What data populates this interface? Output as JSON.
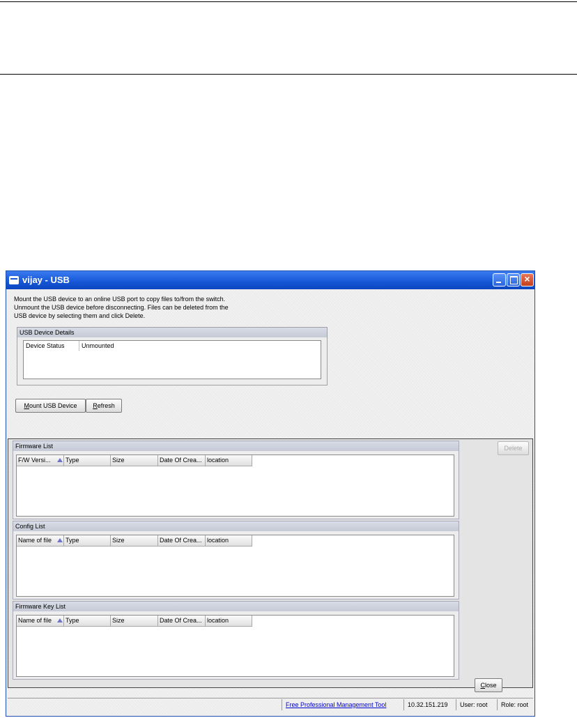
{
  "window": {
    "title": "vijay - USB",
    "close_glyph": "×"
  },
  "description": [
    "Mount the USB device to an online USB port to copy files to/from the switch.",
    "Unmount the USB device before disconnecting. Files can be deleted from the",
    "USB device by selecting them and click Delete."
  ],
  "usb_details": {
    "header": "USB Device Details",
    "rows": [
      {
        "label": "Device Status",
        "value": "Unmounted"
      }
    ]
  },
  "buttons": {
    "mount_mnemonic": "M",
    "mount_rest": "ount USB Device",
    "refresh_mnemonic": "R",
    "refresh_rest": "efresh",
    "delete": "Delete",
    "close_mnemonic": "C",
    "close_rest": "lose"
  },
  "firmware_list": {
    "header": "Firmware List",
    "columns": [
      "F/W Versi...",
      "Type",
      "Size",
      "Date Of Crea...",
      "location"
    ]
  },
  "config_list": {
    "header": "Config List",
    "columns": [
      "Name of file",
      "Type",
      "Size",
      "Date Of Crea...",
      "location"
    ]
  },
  "firmware_key_list": {
    "header": "Firmware Key List",
    "columns": [
      "Name of file",
      "Type",
      "Size",
      "Date Of Crea...",
      "location"
    ]
  },
  "status_bar": {
    "link": "Free Professional Management Tool",
    "ip": "10.32.151.219",
    "user": "User: root",
    "role": "Role: root"
  }
}
